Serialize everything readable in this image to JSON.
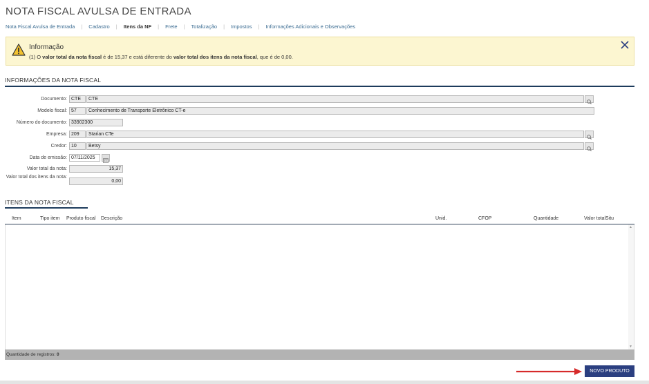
{
  "page_title": "NOTA FISCAL AVULSA DE ENTRADA",
  "tabs": [
    {
      "label": "Nota Fiscal Avulsa de Entrada"
    },
    {
      "label": "Cadastro"
    },
    {
      "label": "Itens da NF"
    },
    {
      "label": "Frete"
    },
    {
      "label": "Totalização"
    },
    {
      "label": "Impostos"
    },
    {
      "label": "Informações Adicionais e Observações"
    }
  ],
  "info": {
    "title": "Informação",
    "msg_prefix": "(1) O ",
    "msg_bold1": "valor total da nota fiscal",
    "msg_mid1": " é de 15,37 e está diferente do ",
    "msg_bold2": "valor total dos itens da nota fiscal",
    "msg_end": ", que é de 0,00."
  },
  "section_info": "INFORMAÇÕES DA NOTA FISCAL",
  "form": {
    "documento": {
      "label": "Documento:",
      "code": "CTE",
      "desc": "CTE"
    },
    "modelo": {
      "label": "Modelo fiscal:",
      "code": "57",
      "desc": "Conhecimento de Transporte Eletrônico CT-e"
    },
    "numero": {
      "label": "Número do documento:",
      "value": "33902300"
    },
    "empresa": {
      "label": "Empresa:",
      "code": "209",
      "desc": "Starian CTe"
    },
    "credor": {
      "label": "Credor:",
      "code": "10",
      "desc": "Betsy"
    },
    "emissao": {
      "label": "Data de emissão:",
      "value": "07/11/2025"
    },
    "valor_total": {
      "label": "Valor total da nota:",
      "value": "15,37"
    },
    "valor_itens": {
      "label": "Valor total dos itens da nota:",
      "value": "0,00"
    }
  },
  "section_items": "ITENS DA NOTA FISCAL",
  "grid": {
    "columns": [
      "Item",
      "Tipo item",
      "Produto fiscal",
      "Descrição",
      "Unid.",
      "CFOP",
      "Quantidade",
      "Valor total",
      "Situ"
    ],
    "footer_label": "Quantidade de registros:",
    "footer_count": "0"
  },
  "buttons": {
    "novo_produto": "NOVO PRODUTO"
  },
  "colors": {
    "accent": "#2b3f80",
    "info_bg": "#fcf6d1",
    "arrow": "#d62a2a",
    "section_line": "#1d3b5c"
  }
}
